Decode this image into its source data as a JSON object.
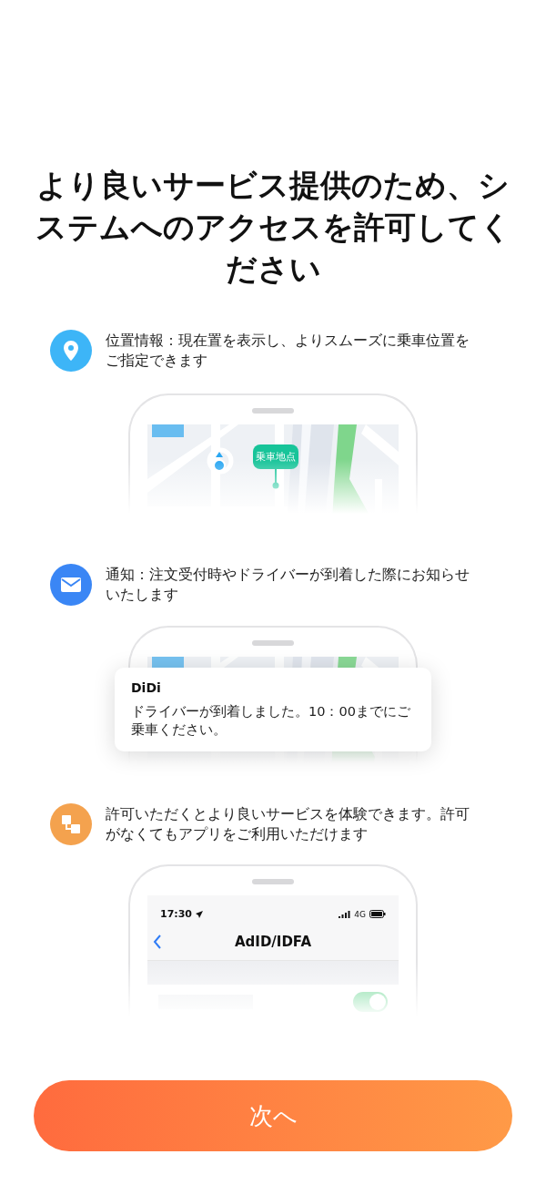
{
  "title": "より良いサービス提供のため、システムへのアクセスを許可してください",
  "permissions": [
    {
      "kind": "location",
      "color": "#3db5f7",
      "text": "位置情報：現在置を表示し、よりスムーズに乗車位置をご指定できます",
      "preview": {
        "kind": "map",
        "pin_label": "乗車地点"
      }
    },
    {
      "kind": "notification",
      "color": "#3a86f5",
      "text": "通知：注文受付時やドライバーが到着した際にお知らせいたします",
      "preview": {
        "kind": "notification",
        "app": "DiDi",
        "message": "ドライバーが到着しました。10：00までにご乗車ください。"
      }
    },
    {
      "kind": "tracking",
      "color": "#f4a24e",
      "text": "許可いただくとより良いサービスを体験できます。許可がなくてもアプリをご利用いただけます",
      "preview": {
        "kind": "settings",
        "time": "17:30",
        "network": "4G",
        "title": "AdID/IDFA",
        "toggle_on": true
      }
    }
  ],
  "next_button": "次へ"
}
